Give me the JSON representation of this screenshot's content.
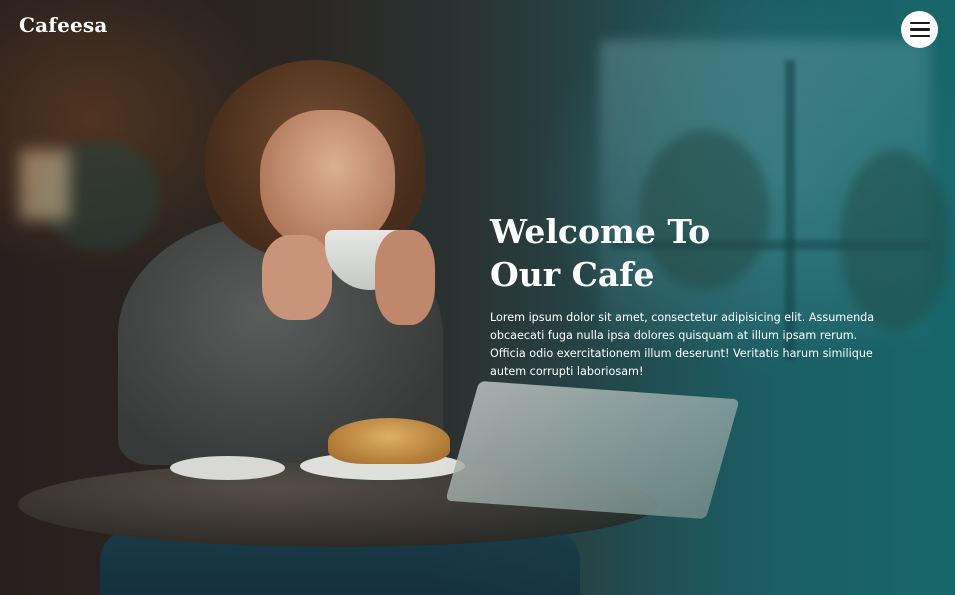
{
  "header": {
    "brand": "Cafeesa",
    "menu_icon": "hamburger-menu-icon"
  },
  "hero": {
    "title": "Welcome To\nOur Cafe",
    "text": "Lorem ipsum dolor sit amet, consectetur adipisicing elit. Assumenda obcaecati fuga nulla ipsa dolores quisquam at illum ipsam rerum. Officia odio exercitationem illum deserunt! Veritatis harum similique autem corrupti laboriosam!",
    "background_image": "woman-drinking-coffee-in-cafe"
  },
  "colors": {
    "text": "#ffffff",
    "menu_button_bg": "#ffffff",
    "menu_icon": "#1a1a1a",
    "overlay_tint": "#1a6a6e"
  }
}
